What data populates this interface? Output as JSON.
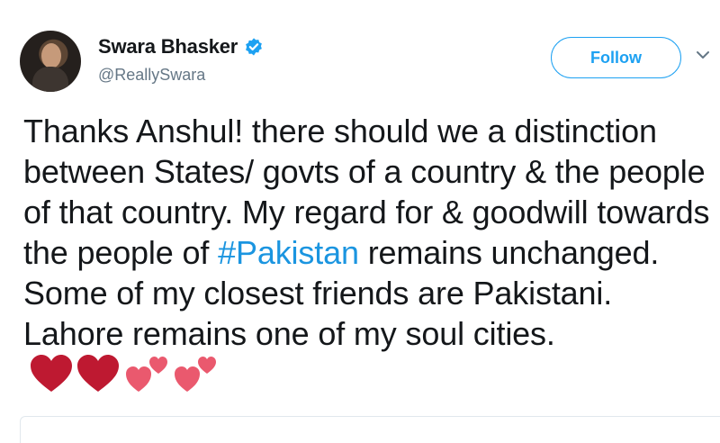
{
  "tweet": {
    "author": {
      "display_name": "Swara Bhasker",
      "handle": "@ReallySwara",
      "verified": true,
      "avatar_icon": "user-avatar-icon"
    },
    "follow_label": "Follow",
    "text_before_hashtag": "Thanks Anshul! there should we a distinction between States/ govts of a country & the people of that country. My regard for & goodwill towards the people of ",
    "hashtag": "#Pakistan",
    "text_after_hashtag": " remains unchanged. Some of my closest friends are Pakistani. Lahore remains one of my soul cities.",
    "emojis": [
      "red-heart-icon",
      "red-heart-icon",
      "two-hearts-icon",
      "two-hearts-icon"
    ]
  },
  "colors": {
    "accent": "#1da1f2",
    "hashtag": "#1b95e0",
    "handle": "#657786",
    "text": "#14171a",
    "heart_red": "#be1931",
    "heart_pink": "#ea596e"
  }
}
